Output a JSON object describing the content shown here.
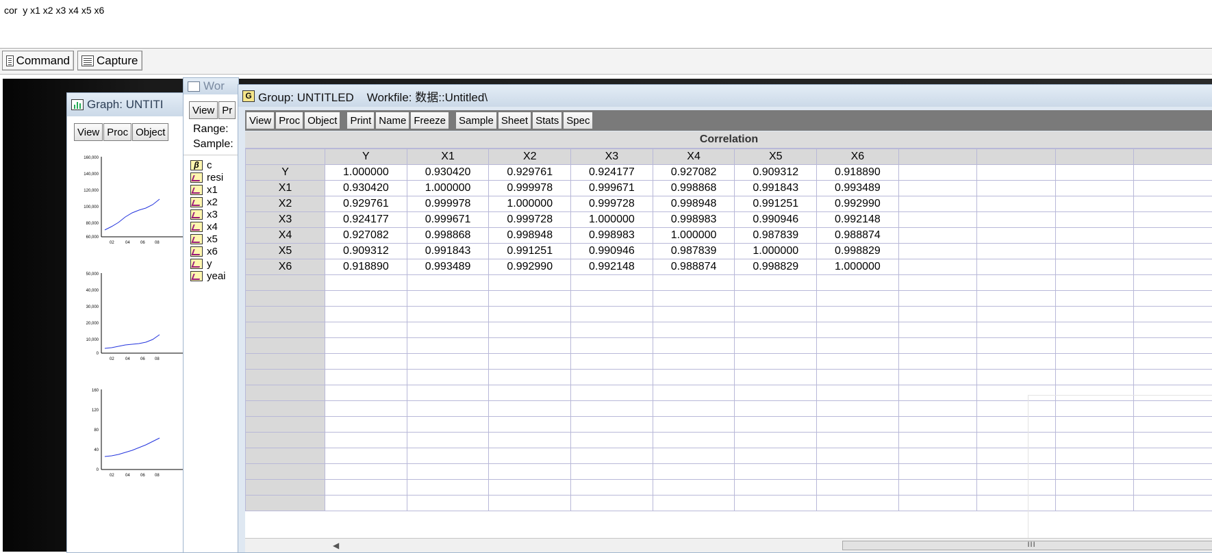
{
  "command_line": "cor  y x1 x2 x3 x4 x5 x6",
  "tabs": [
    {
      "label": "Command"
    },
    {
      "label": "Capture"
    }
  ],
  "graph_window": {
    "title": "Graph: UNTITI",
    "toolbar": [
      "View",
      "Proc",
      "Object"
    ],
    "charts": [
      {
        "ticks": [
          "160,000",
          "140,000",
          "120,000",
          "100,000",
          "80,000",
          "60,000"
        ],
        "xticks": [
          "02",
          "04",
          "06",
          "08"
        ]
      },
      {
        "ticks": [
          "50,000",
          "40,000",
          "30,000",
          "20,000",
          "10,000",
          "0"
        ],
        "xticks": [
          "02",
          "04",
          "06",
          "08"
        ]
      },
      {
        "ticks": [
          "160",
          "120",
          "80",
          "40",
          "0"
        ],
        "xticks": [
          "02",
          "04",
          "06",
          "08"
        ]
      }
    ]
  },
  "workfile_window": {
    "title": "Wor",
    "toolbar": [
      "View",
      "Pr"
    ],
    "range_label": "Range:",
    "sample_label": "Sample:",
    "items": [
      {
        "icon": "coef",
        "label": "c"
      },
      {
        "icon": "series",
        "label": "resi"
      },
      {
        "icon": "series",
        "label": "x1"
      },
      {
        "icon": "series",
        "label": "x2"
      },
      {
        "icon": "series",
        "label": "x3"
      },
      {
        "icon": "series",
        "label": "x4"
      },
      {
        "icon": "series",
        "label": "x5"
      },
      {
        "icon": "series",
        "label": "x6"
      },
      {
        "icon": "series",
        "label": "y"
      },
      {
        "icon": "series",
        "label": "yeai"
      }
    ]
  },
  "group_window": {
    "icon_letter": "G",
    "title": "Group: UNTITLED    Workfile: 数据::Untitled\\",
    "toolbar_groups": [
      [
        "View",
        "Proc",
        "Object"
      ],
      [
        "Print",
        "Name",
        "Freeze"
      ],
      [
        "Sample",
        "Sheet",
        "Stats",
        "Spec"
      ]
    ],
    "table_title": "Correlation",
    "columns": [
      "Y",
      "X1",
      "X2",
      "X3",
      "X4",
      "X5",
      "X6"
    ],
    "rows": [
      {
        "name": "Y",
        "values": [
          "1.000000",
          "0.930420",
          "0.929761",
          "0.924177",
          "0.927082",
          "0.909312",
          "0.918890"
        ]
      },
      {
        "name": "X1",
        "values": [
          "0.930420",
          "1.000000",
          "0.999978",
          "0.999671",
          "0.998868",
          "0.991843",
          "0.993489"
        ]
      },
      {
        "name": "X2",
        "values": [
          "0.929761",
          "0.999978",
          "1.000000",
          "0.999728",
          "0.998948",
          "0.991251",
          "0.992990"
        ]
      },
      {
        "name": "X3",
        "values": [
          "0.924177",
          "0.999671",
          "0.999728",
          "1.000000",
          "0.998983",
          "0.990946",
          "0.992148"
        ]
      },
      {
        "name": "X4",
        "values": [
          "0.927082",
          "0.998868",
          "0.998948",
          "0.998983",
          "1.000000",
          "0.987839",
          "0.988874"
        ]
      },
      {
        "name": "X5",
        "values": [
          "0.909312",
          "0.991843",
          "0.991251",
          "0.990946",
          "0.987839",
          "1.000000",
          "0.998829"
        ]
      },
      {
        "name": "X6",
        "values": [
          "0.918890",
          "0.993489",
          "0.992990",
          "0.992148",
          "0.988874",
          "0.998829",
          "1.000000"
        ]
      }
    ],
    "scroll_grip": "III"
  }
}
